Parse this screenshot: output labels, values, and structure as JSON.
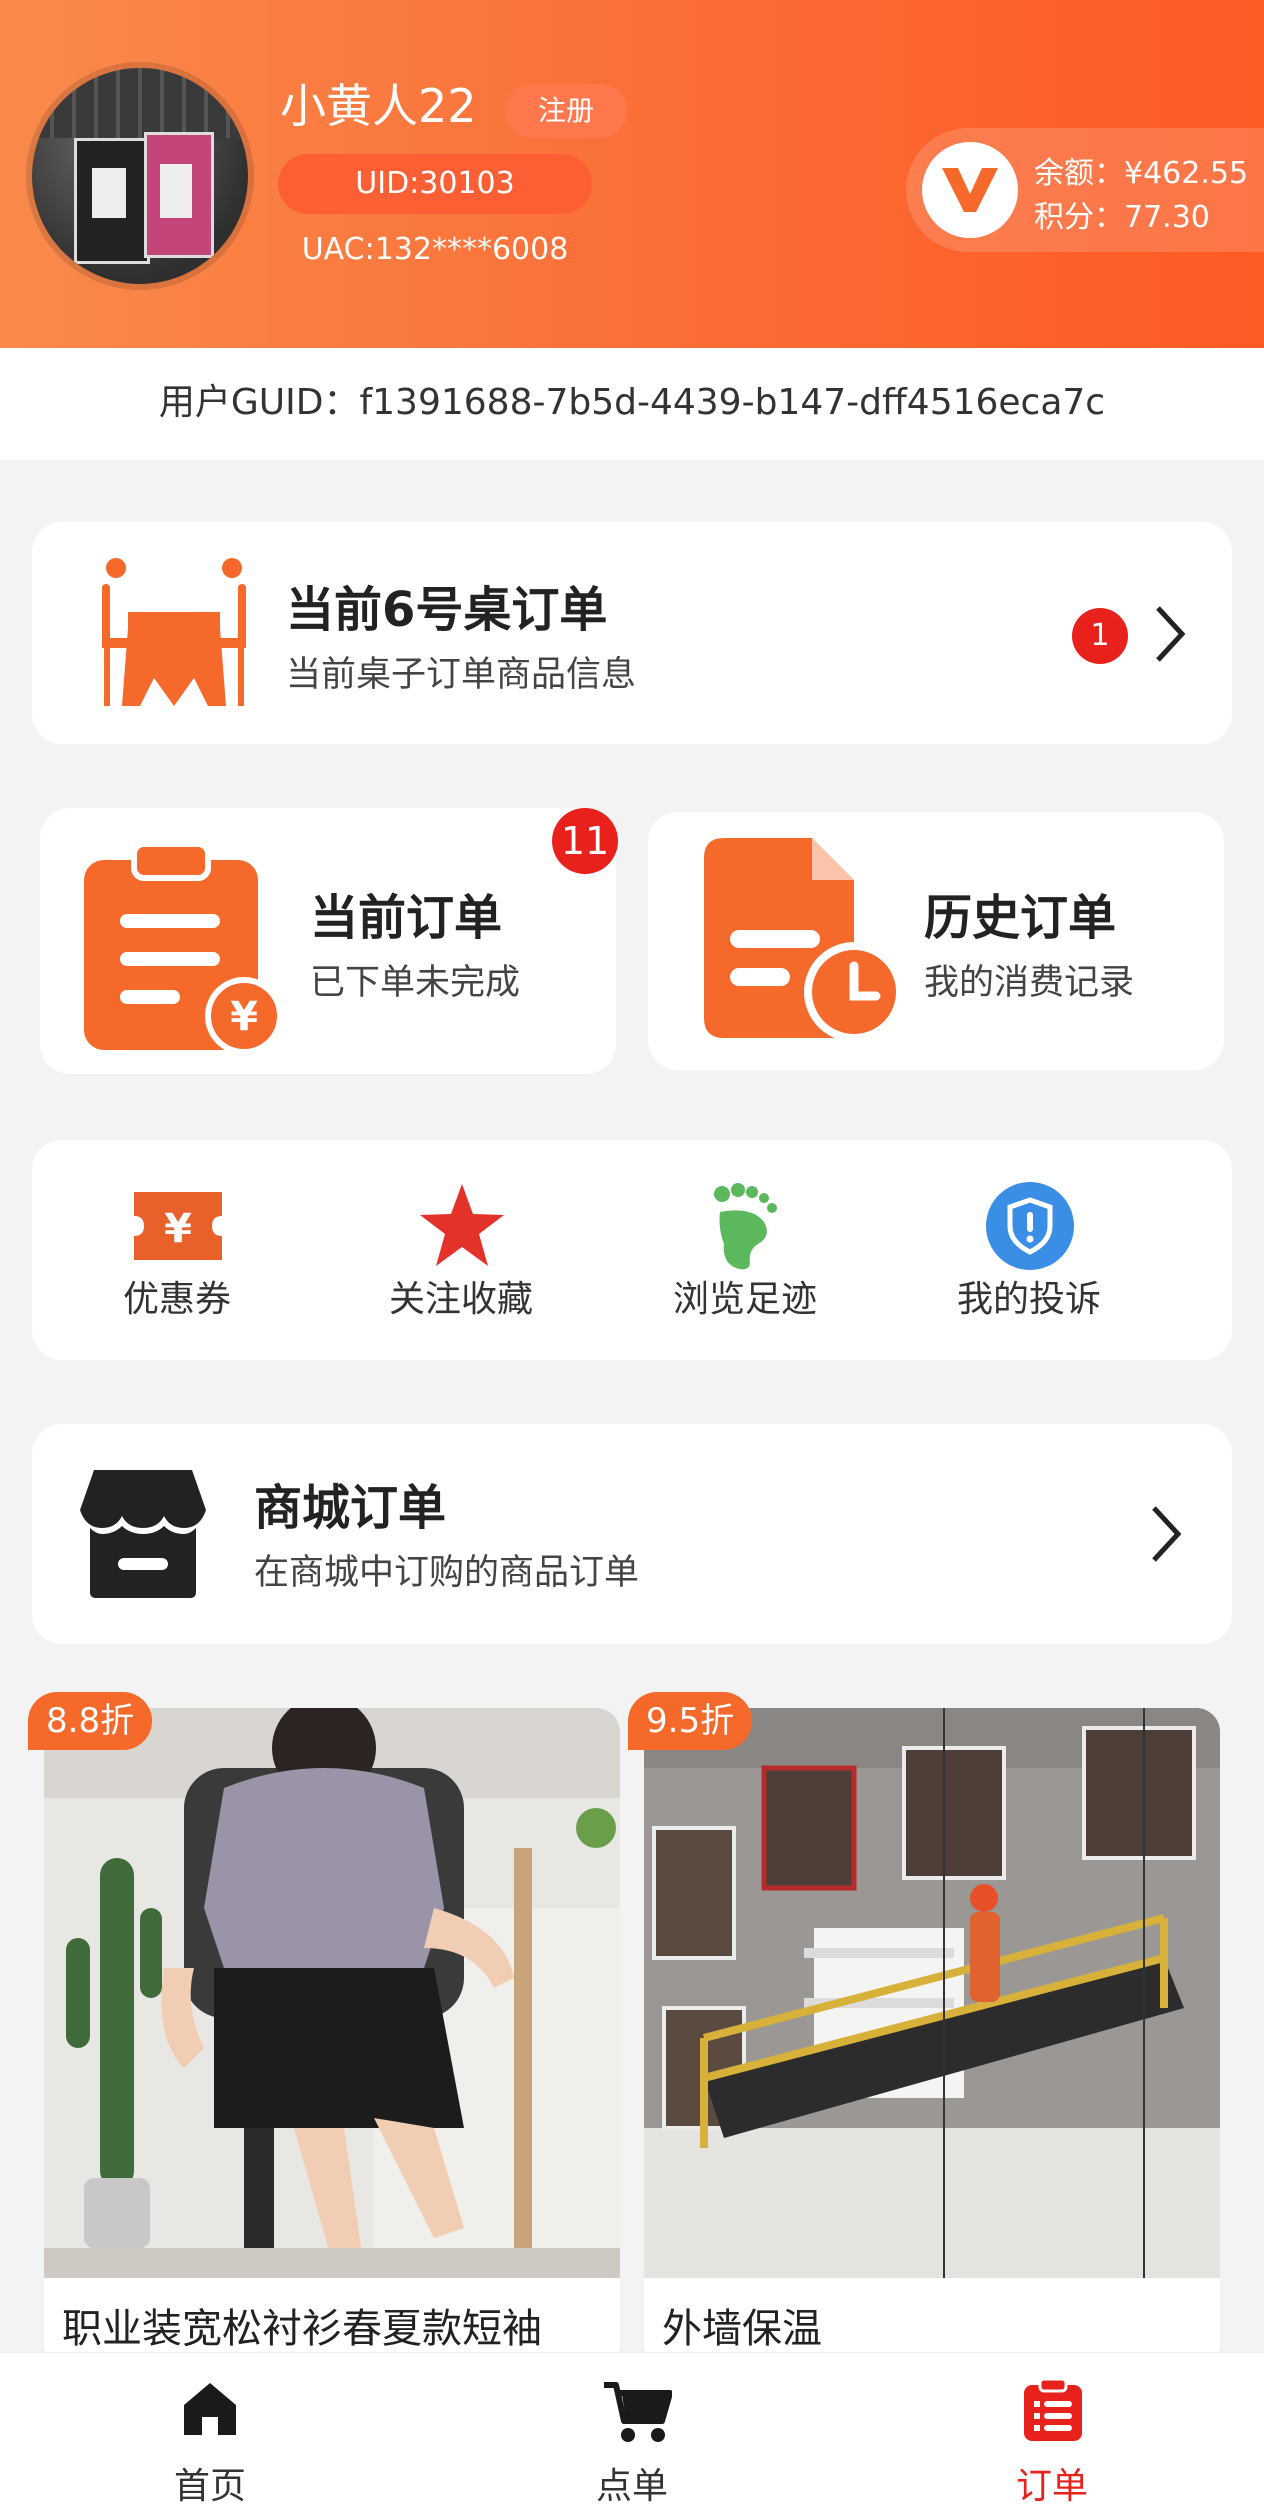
{
  "header": {
    "username": "小黄人22",
    "register_label": "注册",
    "uid": "UID:30103",
    "uac": "UAC:132****6008",
    "balance": "余额：¥462.55",
    "points": "积分：77.30"
  },
  "guid": "用户GUID：f1391688-7b5d-4439-b147-dff4516eca7c",
  "table_order": {
    "title": "当前6号桌订单",
    "subtitle": "当前桌子订单商品信息",
    "badge": "1"
  },
  "current_order": {
    "title": "当前订单",
    "subtitle": "已下单未完成",
    "badge": "11"
  },
  "history_order": {
    "title": "历史订单",
    "subtitle": "我的消费记录"
  },
  "quick_actions": [
    {
      "label": "优惠券",
      "icon": "coupon-icon"
    },
    {
      "label": "关注收藏",
      "icon": "star-icon"
    },
    {
      "label": "浏览足迹",
      "icon": "footprint-icon"
    },
    {
      "label": "我的投诉",
      "icon": "shield-alert-icon"
    }
  ],
  "mall_order": {
    "title": "商城订单",
    "subtitle": "在商城中订购的商品订单"
  },
  "products": [
    {
      "title": "职业装宽松衬衫春夏款短袖",
      "discount": "8.8折"
    },
    {
      "title": "外墙保温",
      "discount": "9.5折"
    }
  ],
  "bottom_nav": [
    {
      "label": "首页",
      "icon": "home-icon"
    },
    {
      "label": "点单",
      "icon": "cart-icon"
    },
    {
      "label": "订单",
      "icon": "order-icon",
      "active": true
    }
  ],
  "colors": {
    "accent": "#f5692a",
    "header_gradient_start": "#f98a4c",
    "header_gradient_end": "#fd5a24",
    "badge_red": "#e8211c",
    "footprint_green": "#5cb85c",
    "shield_blue": "#3a8ee6"
  }
}
